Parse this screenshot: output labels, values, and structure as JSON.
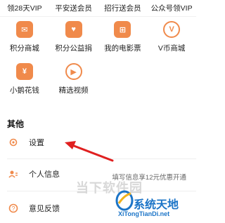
{
  "vip_row": [
    "领28天VIP",
    "平安送会员",
    "招行送会员",
    "公众号领VIP"
  ],
  "grid": [
    {
      "label": "积分商城",
      "icon": "shop-icon",
      "icon_text": "✉",
      "color": "#f08a4b"
    },
    {
      "label": "积分公益捐",
      "icon": "donate-icon",
      "icon_text": "♥",
      "color": "#f08a4b"
    },
    {
      "label": "我的电影票",
      "icon": "ticket-icon",
      "icon_text": "⊞",
      "color": "#f08a4b"
    },
    {
      "label": "V币商城",
      "icon": "vcoin-icon",
      "icon_text": "V",
      "color": "#f08a4b"
    },
    {
      "label": "小鹅花钱",
      "icon": "goose-icon",
      "icon_text": "¥",
      "color": "#f08a4b"
    },
    {
      "label": "精选视频",
      "icon": "video-icon",
      "icon_text": "▶",
      "color": "#f08a4b"
    }
  ],
  "section_title": "其他",
  "list": [
    {
      "label": "设置",
      "icon": "gear-icon"
    },
    {
      "label": "个人信息",
      "icon": "person-icon"
    },
    {
      "label": "意见反馈",
      "icon": "feedback-icon"
    }
  ],
  "hint": "填写信息享12元优惠开通",
  "watermark": {
    "cn": "当下软件园",
    "title": "系统天地",
    "en": "XiTongTianDi.net"
  },
  "accent": "#f08a4b",
  "arrow_color": "#e02020"
}
